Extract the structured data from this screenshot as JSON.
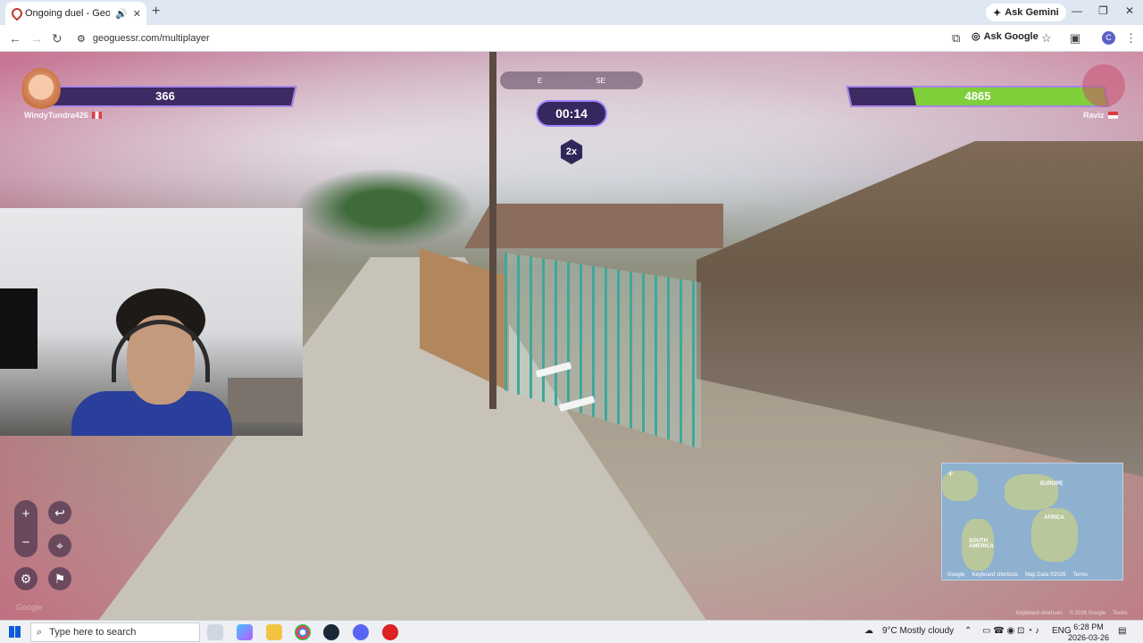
{
  "browser": {
    "tab_title": "Ongoing duel - GeoGuessr",
    "new_tab": "+",
    "ask_gemini": "Ask Gemini",
    "url": "geoguessr.com/multiplayer",
    "ask_google": "Ask Google",
    "profile_initial": "C"
  },
  "game": {
    "compass": {
      "left": "E",
      "right": "SE"
    },
    "timer": "00:14",
    "multiplier": "2x",
    "player_left": {
      "name": "WindyTundra426",
      "hp": "366",
      "hp_fraction": 0.0
    },
    "player_right": {
      "name": "Raviz",
      "hp": "4865",
      "hp_fraction": 0.75
    },
    "watermark": "Google",
    "minimap": {
      "labels": [
        "EUROPE",
        "AFRICA",
        "SOUTH AMERICA"
      ],
      "logo": "Google",
      "footer": [
        "Keyboard shortcuts",
        "Map Data ©2026",
        "Terms"
      ]
    },
    "footer_credit": [
      "Keyboard shortcuts",
      "© 2026 Google",
      "Terms"
    ]
  },
  "taskbar": {
    "search_placeholder": "Type here to search",
    "weather": "9°C  Mostly cloudy",
    "lang": "ENG",
    "time": "6:28 PM",
    "date": "2026-03-26"
  },
  "colors": {
    "accent_purple": "#a384ff",
    "hp_green": "#7fcf3b",
    "fence": "#3fa89a"
  }
}
